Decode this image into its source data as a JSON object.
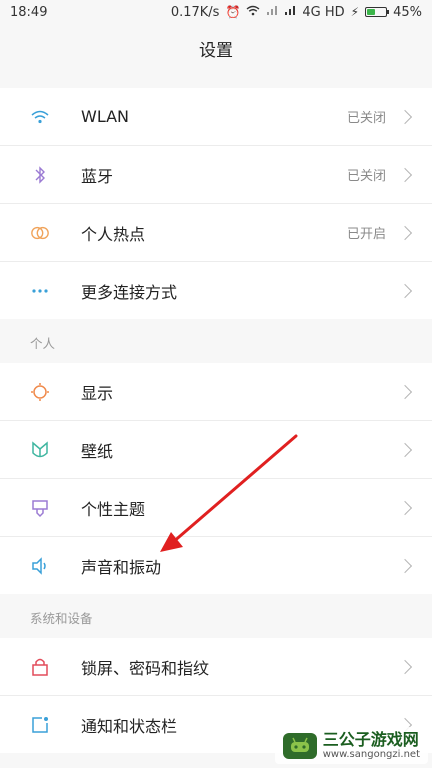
{
  "status_bar": {
    "time": "18:49",
    "speed": "0.17K/s",
    "network": "4G HD",
    "battery": "45%",
    "battery_level": 0.45
  },
  "header": {
    "title": "设置"
  },
  "sections": {
    "connect": {
      "items": [
        {
          "icon": "wifi-icon",
          "label": "WLAN",
          "value": "已关闭"
        },
        {
          "icon": "bluetooth-icon",
          "label": "蓝牙",
          "value": "已关闭"
        },
        {
          "icon": "hotspot-icon",
          "label": "个人热点",
          "value": "已开启"
        },
        {
          "icon": "more-dots-icon",
          "label": "更多连接方式",
          "value": ""
        }
      ]
    },
    "personal": {
      "title": "个人",
      "items": [
        {
          "icon": "display-icon",
          "label": "显示"
        },
        {
          "icon": "wallpaper-icon",
          "label": "壁纸"
        },
        {
          "icon": "theme-icon",
          "label": "个性主题"
        },
        {
          "icon": "sound-icon",
          "label": "声音和振动"
        }
      ]
    },
    "system": {
      "title": "系统和设备",
      "items": [
        {
          "icon": "lock-icon",
          "label": "锁屏、密码和指纹"
        },
        {
          "icon": "notification-icon",
          "label": "通知和状态栏"
        }
      ]
    }
  },
  "colors": {
    "wifi": "#3aa0d8",
    "bluetooth": "#9b7bd3",
    "hotspot": "#f0a35a",
    "more": "#3aa0d8",
    "display": "#f08a4b",
    "wallpaper": "#3fb6a0",
    "theme": "#9b7bd3",
    "sound": "#3aa0d8",
    "lock": "#e24b5a",
    "notification": "#3aa0d8",
    "annotation_arrow": "#e02020"
  },
  "watermark": {
    "title": "三公子游戏网",
    "url": "www.sangongzi.net"
  }
}
